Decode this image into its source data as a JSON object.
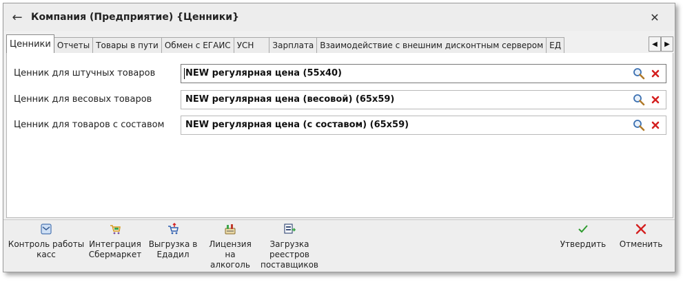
{
  "window": {
    "title": "Компания (Предприятие) {Ценники}",
    "back_icon": "arrow-left-icon",
    "close_icon": "close-icon"
  },
  "tabs": [
    {
      "label": "Ценники",
      "active": true
    },
    {
      "label": "Отчеты"
    },
    {
      "label": "Товары в пути"
    },
    {
      "label": "Обмен с ЕГАИС"
    },
    {
      "label": "УСН"
    },
    {
      "label": "Зарплата"
    },
    {
      "label": "Взаимодействие с внешним дисконтным сервером"
    },
    {
      "label": "ЕД"
    }
  ],
  "tab_scroll": {
    "left": "◀",
    "right": "▶"
  },
  "rows": [
    {
      "label": "Ценник для штучных товаров",
      "value": "NEW регулярная цена (55x40)"
    },
    {
      "label": "Ценник для весовых товаров",
      "value": "NEW регулярная цена (весовой) (65x59)"
    },
    {
      "label": "Ценник для товаров с составом",
      "value": "NEW регулярная цена (с составом) (65x59)"
    }
  ],
  "toolbar": {
    "left": [
      {
        "label": "Контроль работы\nкасс",
        "icon": "register-icon"
      },
      {
        "label": "Интеграция\nСбермаркет",
        "icon": "cart-icon"
      },
      {
        "label": "Выгрузка в\nЕдадил",
        "icon": "upload-cart-icon"
      },
      {
        "label": "Лицензия на\nалкоголь",
        "icon": "license-icon"
      },
      {
        "label": "Загрузка\nреестров\nпоставщиков",
        "icon": "import-icon"
      }
    ],
    "right": [
      {
        "label": "Утвердить",
        "icon": "check-icon"
      },
      {
        "label": "Отменить",
        "icon": "cancel-icon"
      }
    ]
  },
  "colors": {
    "check": "#2e9b2e",
    "cancel": "#d42020",
    "search": "#3a6fb0"
  }
}
